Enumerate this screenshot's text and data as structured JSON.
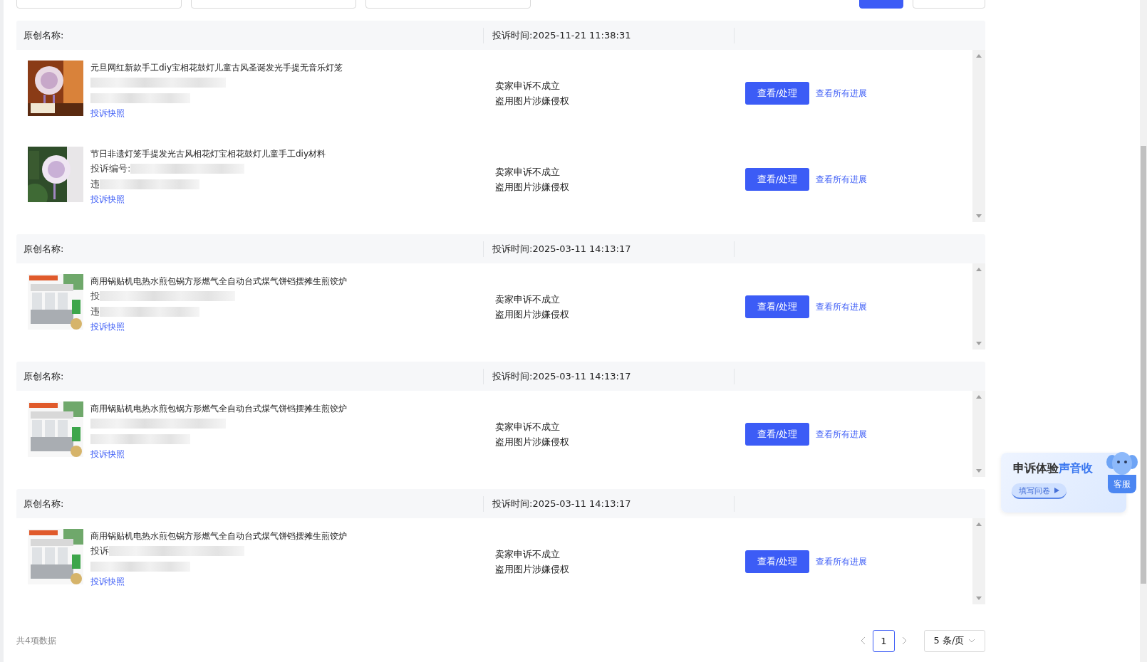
{
  "cards": [
    {
      "header_label": "原创名称:",
      "time": "投诉时间:2025-11-21 11:38:31",
      "products": [
        {
          "title": "元旦网红新款手工diy宝相花鼓灯儿童古风圣诞发光手提无音乐灯笼",
          "snapshot_link": "投诉快照",
          "status": [
            "卖家申诉不成立",
            "盗用图片涉嫌侵权"
          ],
          "action_button": "查看/处理",
          "progress_link": "查看所有进展"
        },
        {
          "title": "节日非遗灯笼手提发光古风相花灯宝相花鼓灯儿童手工diy材料",
          "number_prefix": "投诉编号:",
          "violation_prefix": "违",
          "snapshot_link": "投诉快照",
          "status": [
            "卖家申诉不成立",
            "盗用图片涉嫌侵权"
          ],
          "action_button": "查看/处理",
          "progress_link": "查看所有进展"
        }
      ]
    },
    {
      "header_label": "原创名称:",
      "time": "投诉时间:2025-03-11 14:13:17",
      "products": [
        {
          "title": "商用锅贴机电热水煎包锅方形燃气全自动台式煤气饼铛摆摊生煎饺炉",
          "number_prefix": "投",
          "violation_prefix": "违",
          "snapshot_link": "投诉快照",
          "status": [
            "卖家申诉不成立",
            "盗用图片涉嫌侵权"
          ],
          "action_button": "查看/处理",
          "progress_link": "查看所有进展"
        }
      ]
    },
    {
      "header_label": "原创名称:",
      "time": "投诉时间:2025-03-11 14:13:17",
      "products": [
        {
          "title": "商用锅贴机电热水煎包锅方形燃气全自动台式煤气饼铛摆摊生煎饺炉",
          "snapshot_link": "投诉快照",
          "status": [
            "卖家申诉不成立",
            "盗用图片涉嫌侵权"
          ],
          "action_button": "查看/处理",
          "progress_link": "查看所有进展"
        }
      ]
    },
    {
      "header_label": "原创名称:",
      "time": "投诉时间:2025-03-11 14:13:17",
      "products": [
        {
          "title": "商用锅贴机电热水煎包锅方形燃气全自动台式煤气饼铛摆摊生煎饺炉",
          "number_prefix": "投诉",
          "snapshot_link": "投诉快照",
          "status": [
            "卖家申诉不成立",
            "盗用图片涉嫌侵权"
          ],
          "action_button": "查看/处理",
          "progress_link": "查看所有进展"
        }
      ]
    }
  ],
  "footer": {
    "total": "共4项数据",
    "pages": [
      {
        "label": "1",
        "selected": true
      }
    ],
    "page_size": "5 条/页"
  },
  "widget": {
    "title": "申诉体验",
    "title_highlight": "声音收",
    "button": "填写问卷",
    "badge": "客服"
  }
}
